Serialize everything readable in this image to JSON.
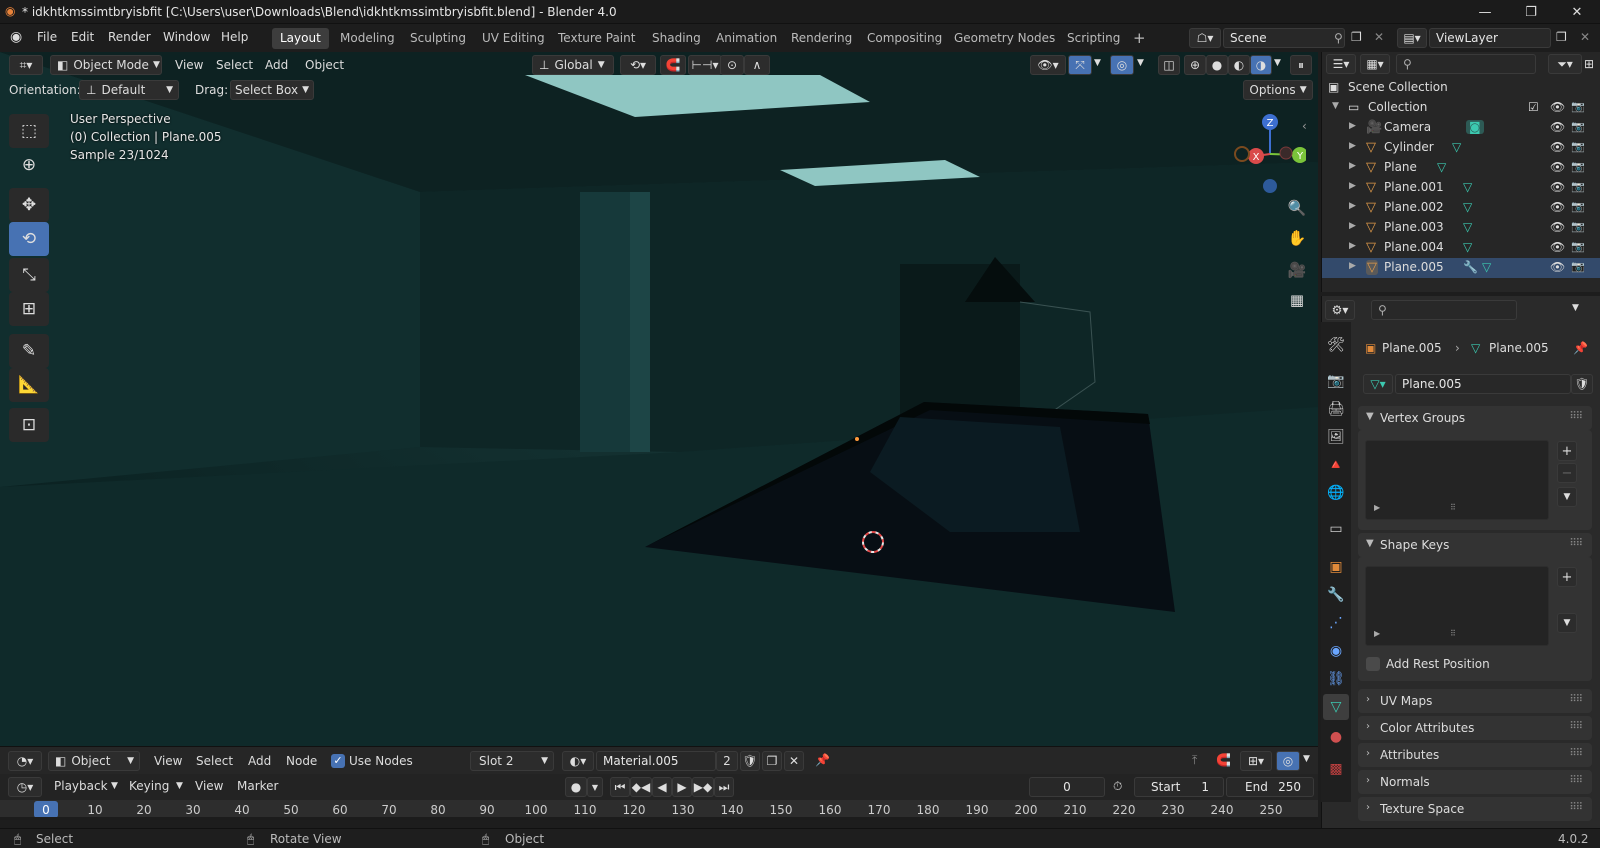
{
  "window": {
    "title": "* idkhtkmssimtbryisbfit [C:\\Users\\user\\Downloads\\Blend\\idkhtkmssimtbryisbfit.blend] - Blender 4.0",
    "minimize": "—",
    "maximize": "❐",
    "close": "✕"
  },
  "menu": {
    "items": [
      "File",
      "Edit",
      "Render",
      "Window",
      "Help"
    ]
  },
  "workspaces": {
    "tabs": [
      "Layout",
      "Modeling",
      "Sculpting",
      "UV Editing",
      "Texture Paint",
      "Shading",
      "Animation",
      "Rendering",
      "Compositing",
      "Geometry Nodes",
      "Scripting"
    ],
    "active": "Layout",
    "add": "+"
  },
  "scene": {
    "name": "Scene",
    "view_layer": "ViewLayer"
  },
  "viewport_header": {
    "mode": "Object Mode",
    "menus": [
      "View",
      "Select",
      "Add",
      "Object"
    ],
    "transform_orientation": "Global",
    "orientation_label": "Orientation:",
    "orientation_value": "Default",
    "drag_label": "Drag:",
    "drag_value": "Select Box",
    "options": "Options"
  },
  "viewport_hud": {
    "perspective": "User Perspective",
    "collection": "(0) Collection | Plane.005",
    "sample": "Sample 23/1024"
  },
  "gizmo": {
    "z": "Z",
    "x": "X",
    "y": "Y"
  },
  "outliner": {
    "root": "Scene Collection",
    "collection": "Collection",
    "objects": [
      "Camera",
      "Cylinder",
      "Plane",
      "Plane.001",
      "Plane.002",
      "Plane.003",
      "Plane.004",
      "Plane.005"
    ]
  },
  "properties": {
    "breadcrumb_object": "Plane.005",
    "breadcrumb_mesh": "Plane.005",
    "mesh_name": "Plane.005",
    "panels": {
      "vertex_groups": "Vertex Groups",
      "shape_keys": "Shape Keys",
      "add_rest_position": "Add Rest Position",
      "uv_maps": "UV Maps",
      "color_attributes": "Color Attributes",
      "attributes": "Attributes",
      "normals": "Normals",
      "texture_space": "Texture Space"
    }
  },
  "node_editor_header": {
    "object_type": "Object",
    "menus": [
      "View",
      "Select",
      "Add",
      "Node"
    ],
    "use_nodes": "Use Nodes",
    "slot": "Slot 2",
    "material": "Material.005",
    "users": "2"
  },
  "timeline_header": {
    "menus": [
      "Playback",
      "Keying",
      "View",
      "Marker"
    ],
    "current_frame": "0",
    "start_label": "Start",
    "start": "1",
    "end_label": "End",
    "end": "250"
  },
  "timeline_ruler": {
    "ticks": [
      "0",
      "10",
      "20",
      "30",
      "40",
      "50",
      "60",
      "70",
      "80",
      "90",
      "100",
      "110",
      "120",
      "130",
      "140",
      "150",
      "160",
      "170",
      "180",
      "190",
      "200",
      "210",
      "220",
      "230",
      "240",
      "250"
    ]
  },
  "statusbar": {
    "select": "Select",
    "rotate": "Rotate View",
    "object": "Object",
    "version": "4.0.2"
  },
  "colors": {
    "accent": "#4772b3",
    "mesh_icon": "#3cc9b0",
    "object_icon": "#e09a4a",
    "current_frame": "#4772b3"
  }
}
